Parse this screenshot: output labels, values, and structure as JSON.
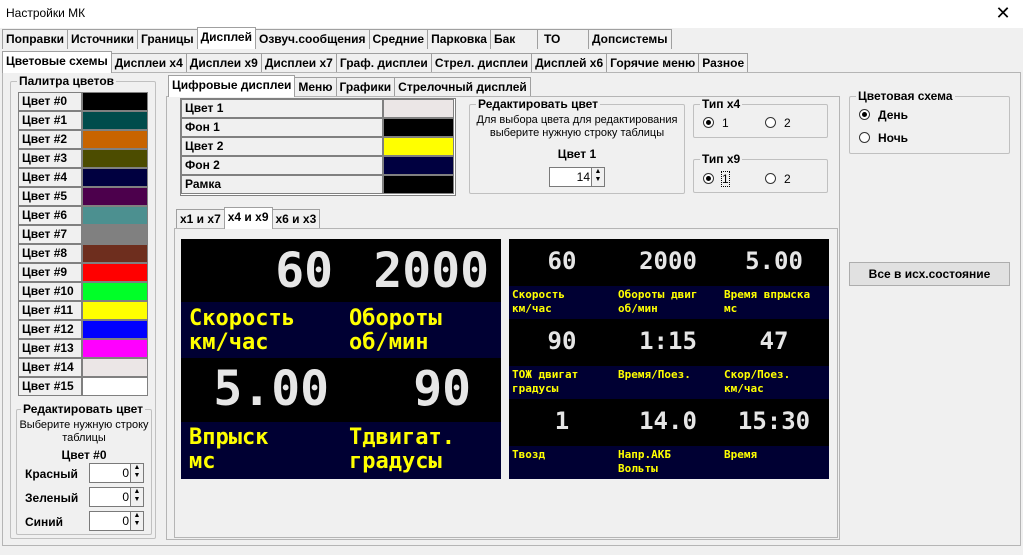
{
  "window": {
    "title": "Настройки МК",
    "close_glyph": "✕"
  },
  "top_tabs": [
    "Поправки",
    "Источники",
    "Границы",
    "Дисплей",
    "Озвуч.сообщения",
    "Средние",
    "Парковка",
    "Бак",
    "ТО",
    "Допсистемы"
  ],
  "second_tabs": [
    "Цветовые схемы",
    "Дисплеи x4",
    "Дисплеи x9",
    "Дисплеи x7",
    "Граф. дисплеи",
    "Стрел. дисплеи",
    "Дисплей x6",
    "Горячие меню",
    "Разное"
  ],
  "palette": {
    "title": "Палитра цветов",
    "items": [
      {
        "label": "Цвет #0",
        "color": "#000000"
      },
      {
        "label": "Цвет #1",
        "color": "#004c4c"
      },
      {
        "label": "Цвет #2",
        "color": "#c86400"
      },
      {
        "label": "Цвет #3",
        "color": "#4c4c00"
      },
      {
        "label": "Цвет #4",
        "color": "#000040"
      },
      {
        "label": "Цвет #5",
        "color": "#4c004c"
      },
      {
        "label": "Цвет #6",
        "color": "#4c9090"
      },
      {
        "label": "Цвет #7",
        "color": "#808080"
      },
      {
        "label": "Цвет #8",
        "color": "#6e2e1e"
      },
      {
        "label": "Цвет #9",
        "color": "#ff0000"
      },
      {
        "label": "Цвет #10",
        "color": "#00ff28"
      },
      {
        "label": "Цвет #11",
        "color": "#ffff00"
      },
      {
        "label": "Цвет #12",
        "color": "#0000ff"
      },
      {
        "label": "Цвет #13",
        "color": "#ff00ff"
      },
      {
        "label": "Цвет #14",
        "color": "#ebe6e6"
      },
      {
        "label": "Цвет #15",
        "color": "#ffffff"
      }
    ]
  },
  "edit_left": {
    "title": "Редактировать цвет",
    "hint": "Выберите нужную строку таблицы",
    "current": "Цвет #0",
    "fields": [
      {
        "label": "Красный",
        "value": "0"
      },
      {
        "label": "Зеленый",
        "value": "0"
      },
      {
        "label": "Синий",
        "value": "0"
      }
    ]
  },
  "inner_tabs": [
    "Цифровые дисплеи",
    "Меню",
    "Графики",
    "Стрелочный дисплей"
  ],
  "color_table": [
    {
      "label": "Цвет 1",
      "color": "#ebe6e6"
    },
    {
      "label": "Фон 1",
      "color": "#000000"
    },
    {
      "label": "Цвет 2",
      "color": "#ffff00"
    },
    {
      "label": "Фон 2",
      "color": "#000040"
    },
    {
      "label": "Рамка",
      "color": "#000000"
    }
  ],
  "edit_mid": {
    "title": "Редактировать цвет",
    "hint": "Для выбора цвета для редактирования выберите нужную строку таблицы",
    "current": "Цвет 1",
    "value": "14"
  },
  "type_x4": {
    "title": "Тип x4",
    "options": [
      "1",
      "2"
    ],
    "selected": "1"
  },
  "type_x9": {
    "title": "Тип x9",
    "options": [
      "1",
      "2"
    ],
    "selected": "1"
  },
  "scheme": {
    "title": "Цветовая схема",
    "options": [
      "День",
      "Ночь"
    ],
    "selected": "День"
  },
  "reset_button": "Все в исх.состояние",
  "display_tabs": [
    "x1 и x7",
    "x4 и x9",
    "x6 и x3"
  ],
  "x4_display": [
    {
      "value": "60",
      "label1": "Скорость",
      "label2": "км/час"
    },
    {
      "value": "2000",
      "label1": "Обороты",
      "label2": "об/мин"
    },
    {
      "value": "5.00",
      "label1": "Впрыск",
      "label2": "мс"
    },
    {
      "value": "90",
      "label1": "Тдвигат.",
      "label2": "градусы"
    }
  ],
  "x9_display": [
    {
      "value": "60",
      "label1": "Скорость",
      "label2": "км/час"
    },
    {
      "value": "2000",
      "label1": "Обороты двиг",
      "label2": "об/мин"
    },
    {
      "value": "5.00",
      "label1": "Время впрыска",
      "label2": "мс"
    },
    {
      "value": "90",
      "label1": "ТОЖ двигат",
      "label2": "градусы"
    },
    {
      "value": "1:15",
      "label1": "Время/Поез.",
      "label2": ""
    },
    {
      "value": "47",
      "label1": "Скор/Поез.",
      "label2": "км/час"
    },
    {
      "value": "1",
      "label1": "Твозд",
      "label2": ""
    },
    {
      "value": "14.0",
      "label1": "Напр.АКБ",
      "label2": "Вольты"
    },
    {
      "value": "15:30",
      "label1": "Время",
      "label2": ""
    }
  ],
  "colors": {
    "digit": "#e6e6e6",
    "label": "#ffff00",
    "band": "#000033",
    "screen": "#000000"
  }
}
